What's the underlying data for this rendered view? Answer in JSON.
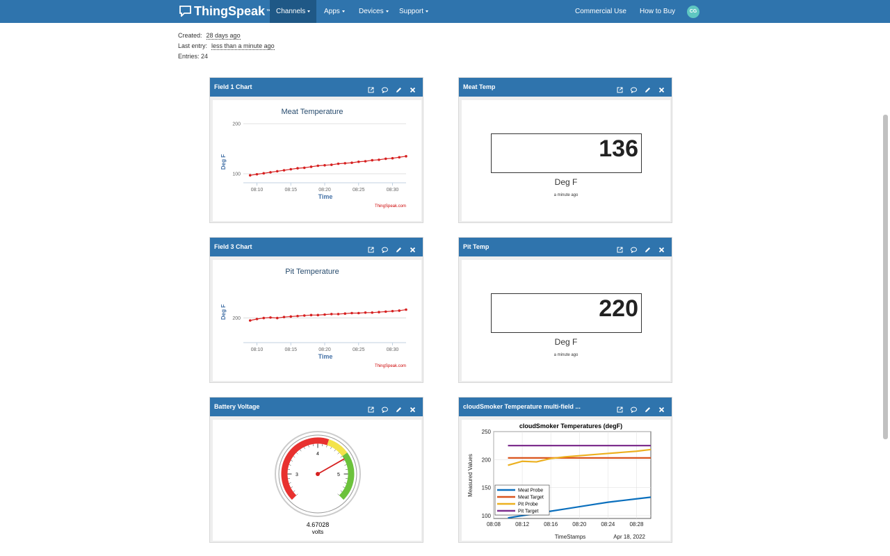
{
  "nav": {
    "brand": "ThingSpeak",
    "tm": "™",
    "items": [
      "Channels",
      "Apps",
      "Devices",
      "Support"
    ],
    "right_items": [
      "Commercial Use",
      "How to Buy"
    ],
    "avatar": "CG"
  },
  "channel": {
    "created_label": "Created:",
    "created_value": "28 days ago",
    "last_entry_label": "Last entry:",
    "last_entry_value": "less than a minute ago",
    "entries": "Entries: 24"
  },
  "widgets": {
    "w1": {
      "title": "Field 1 Chart"
    },
    "w2": {
      "title": "Meat Temp",
      "value": "136",
      "unit": "Deg F",
      "ago": "a minute ago"
    },
    "w3": {
      "title": "Field 3 Chart"
    },
    "w4": {
      "title": "Pit Temp",
      "value": "220",
      "unit": "Deg F",
      "ago": "a minute ago"
    },
    "w5": {
      "title": "Battery Voltage",
      "value": "4.67028",
      "unit": "volts",
      "ticks": [
        "3",
        "4",
        "5"
      ]
    },
    "w6": {
      "title": "cloudSmoker Temperature multi-field ..."
    }
  },
  "chart_data": [
    {
      "type": "line",
      "title": "Meat Temperature",
      "xlabel": "Time",
      "ylabel": "Deg F",
      "x_ticks": [
        "08:10",
        "08:15",
        "08:20",
        "08:25",
        "08:30"
      ],
      "y_ticks": [
        "100",
        "200"
      ],
      "ylim": [
        82,
        200
      ],
      "watermark": "ThingSpeak.com",
      "color": "#d62020",
      "x": [
        "08:09",
        "08:10",
        "08:11",
        "08:12",
        "08:13",
        "08:14",
        "08:15",
        "08:16",
        "08:17",
        "08:18",
        "08:19",
        "08:20",
        "08:21",
        "08:22",
        "08:23",
        "08:24",
        "08:25",
        "08:26",
        "08:27",
        "08:28",
        "08:29",
        "08:30",
        "08:31",
        "08:32"
      ],
      "values": [
        97,
        99,
        101,
        103,
        105,
        107,
        109,
        111,
        112,
        114,
        116,
        117,
        118,
        120,
        121,
        122,
        124,
        125,
        127,
        128,
        130,
        131,
        133,
        135
      ]
    },
    {
      "type": "line",
      "title": "Pit Temperature",
      "xlabel": "Time",
      "ylabel": "Deg F",
      "x_ticks": [
        "08:10",
        "08:15",
        "08:20",
        "08:25",
        "08:30"
      ],
      "y_ticks": [
        "200"
      ],
      "ylim": [
        150,
        270
      ],
      "watermark": "ThingSpeak.com",
      "color": "#d62020",
      "x": [
        "08:09",
        "08:10",
        "08:11",
        "08:12",
        "08:13",
        "08:14",
        "08:15",
        "08:16",
        "08:17",
        "08:18",
        "08:19",
        "08:20",
        "08:21",
        "08:22",
        "08:23",
        "08:24",
        "08:25",
        "08:26",
        "08:27",
        "08:28",
        "08:29",
        "08:30",
        "08:31",
        "08:32"
      ],
      "values": [
        195,
        198,
        200,
        201,
        200,
        202,
        203,
        204,
        205,
        206,
        206,
        207,
        208,
        208,
        209,
        210,
        210,
        211,
        211,
        212,
        213,
        214,
        215,
        217
      ]
    },
    {
      "type": "gauge",
      "title": "Battery Voltage",
      "value": 4.67028,
      "unit": "volts",
      "range": [
        2.5,
        5.5
      ],
      "ticks": [
        3,
        4,
        5
      ],
      "bands": [
        {
          "from": 2.5,
          "to": 4.2,
          "color": "#e8312f"
        },
        {
          "from": 4.2,
          "to": 4.6,
          "color": "#f3e34a"
        },
        {
          "from": 4.6,
          "to": 5.5,
          "color": "#6cc23c"
        }
      ]
    },
    {
      "type": "line",
      "title": "cloudSmoker Temperatures (degF)",
      "xlabel": "TimeStamps",
      "ylabel": "Measured Values",
      "date_label": "Apr 18, 2022",
      "x_ticks": [
        "08:08",
        "08:12",
        "08:16",
        "08:20",
        "08:24",
        "08:28"
      ],
      "y_ticks": [
        "100",
        "150",
        "200",
        "250"
      ],
      "ylim": [
        95,
        250
      ],
      "grid": true,
      "legend_position": "bottom-left",
      "x": [
        "08:10",
        "08:12",
        "08:14",
        "08:16",
        "08:18",
        "08:20",
        "08:22",
        "08:24",
        "08:26",
        "08:28",
        "08:30"
      ],
      "series": [
        {
          "name": "Meat Probe",
          "color": "#0a6fbd",
          "values": [
            96,
            100,
            104,
            108,
            112,
            116,
            120,
            124,
            127,
            130,
            133
          ]
        },
        {
          "name": "Meat Target",
          "color": "#d9541c",
          "values": [
            203,
            203,
            203,
            203,
            203,
            203,
            203,
            203,
            203,
            203,
            203
          ]
        },
        {
          "name": "Pit Probe",
          "color": "#ecb01f",
          "values": [
            190,
            197,
            196,
            202,
            205,
            207,
            209,
            211,
            213,
            215,
            218
          ]
        },
        {
          "name": "Pit Target",
          "color": "#7e2f8e",
          "values": [
            225,
            225,
            225,
            225,
            225,
            225,
            225,
            225,
            225,
            225,
            225
          ]
        }
      ]
    }
  ]
}
